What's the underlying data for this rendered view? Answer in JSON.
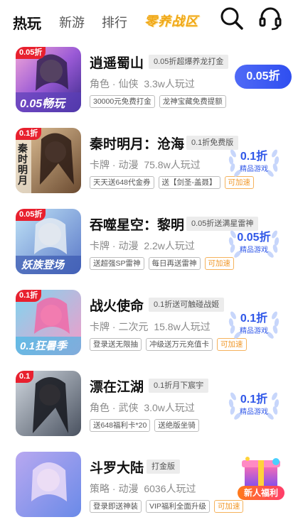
{
  "header": {
    "tabs": [
      {
        "label": "热玩",
        "active": true
      },
      {
        "label": "新游",
        "active": false
      },
      {
        "label": "排行",
        "active": false
      }
    ],
    "special_tab": "零养战区",
    "search_icon": "search-icon",
    "service_icon": "headset-icon"
  },
  "games": [
    {
      "title": "逍遥蜀山",
      "badge": "0.05折超爆养龙打金",
      "genre": "角色 · 仙侠",
      "players": "3.3w人玩过",
      "tags": [
        "30000元免费打金",
        "龙神宝藏免费提额"
      ],
      "action": "0.05折",
      "action_type": "button",
      "thumb_tag": "0.05折",
      "thumb_text": "0.05畅玩"
    },
    {
      "title": "秦时明月：沧海",
      "badge": "0.1折免费版",
      "genre": "卡牌 · 动漫",
      "players": "75.8w人玩过",
      "tags": [
        "天天送648代金券",
        "送【剑圣-盖聂】",
        "可加速"
      ],
      "action": "0.1折",
      "action_sub": "精品游戏",
      "action_type": "wreath",
      "thumb_tag": "0.1折",
      "thumb_text": "秦时明月"
    },
    {
      "title": "吞噬星空：黎明",
      "badge": "0.05折送满星雷神",
      "genre": "卡牌 · 动漫",
      "players": "2.2w人玩过",
      "tags": [
        "送超强SP雷神",
        "每日再送雷神",
        "可加速"
      ],
      "action": "0.05折",
      "action_sub": "精品游戏",
      "action_type": "wreath",
      "thumb_tag": "0.05折",
      "thumb_text": "妖族登场"
    },
    {
      "title": "战火使命",
      "badge": "0.1折送可触碰战姬",
      "genre": "卡牌 · 二次元",
      "players": "15.8w人玩过",
      "tags": [
        "登录送无限抽",
        "冲级送万元充值卡",
        "可加速"
      ],
      "action": "0.1折",
      "action_sub": "精品游戏",
      "action_type": "wreath",
      "thumb_tag": "0.1折",
      "thumb_text": "0.1狂暑季"
    },
    {
      "title": "漂在江湖",
      "badge": "0.1折月下宸宇",
      "genre": "角色 · 武侠",
      "players": "3.0w人玩过",
      "tags": [
        "送648福利卡*20",
        "送绝版坐骑"
      ],
      "action": "0.1折",
      "action_sub": "精品游戏",
      "action_type": "wreath",
      "thumb_tag": "0.1",
      "thumb_text": ""
    },
    {
      "title": "斗罗大陆",
      "badge": "打金版",
      "genre": "策略 · 动漫",
      "players": "6036人玩过",
      "tags": [
        "登录即送神装",
        "VIP福利全面升级",
        "可加速"
      ],
      "action": "",
      "action_type": "none",
      "thumb_tag": "",
      "thumb_text": ""
    }
  ],
  "floating_gift": {
    "label": "新人福利",
    "icon": "gift-box-icon"
  },
  "colors": {
    "accent_blue": "#2f57e8",
    "tag_orange": "#f0982a",
    "thumb_red": "#e8202e"
  }
}
